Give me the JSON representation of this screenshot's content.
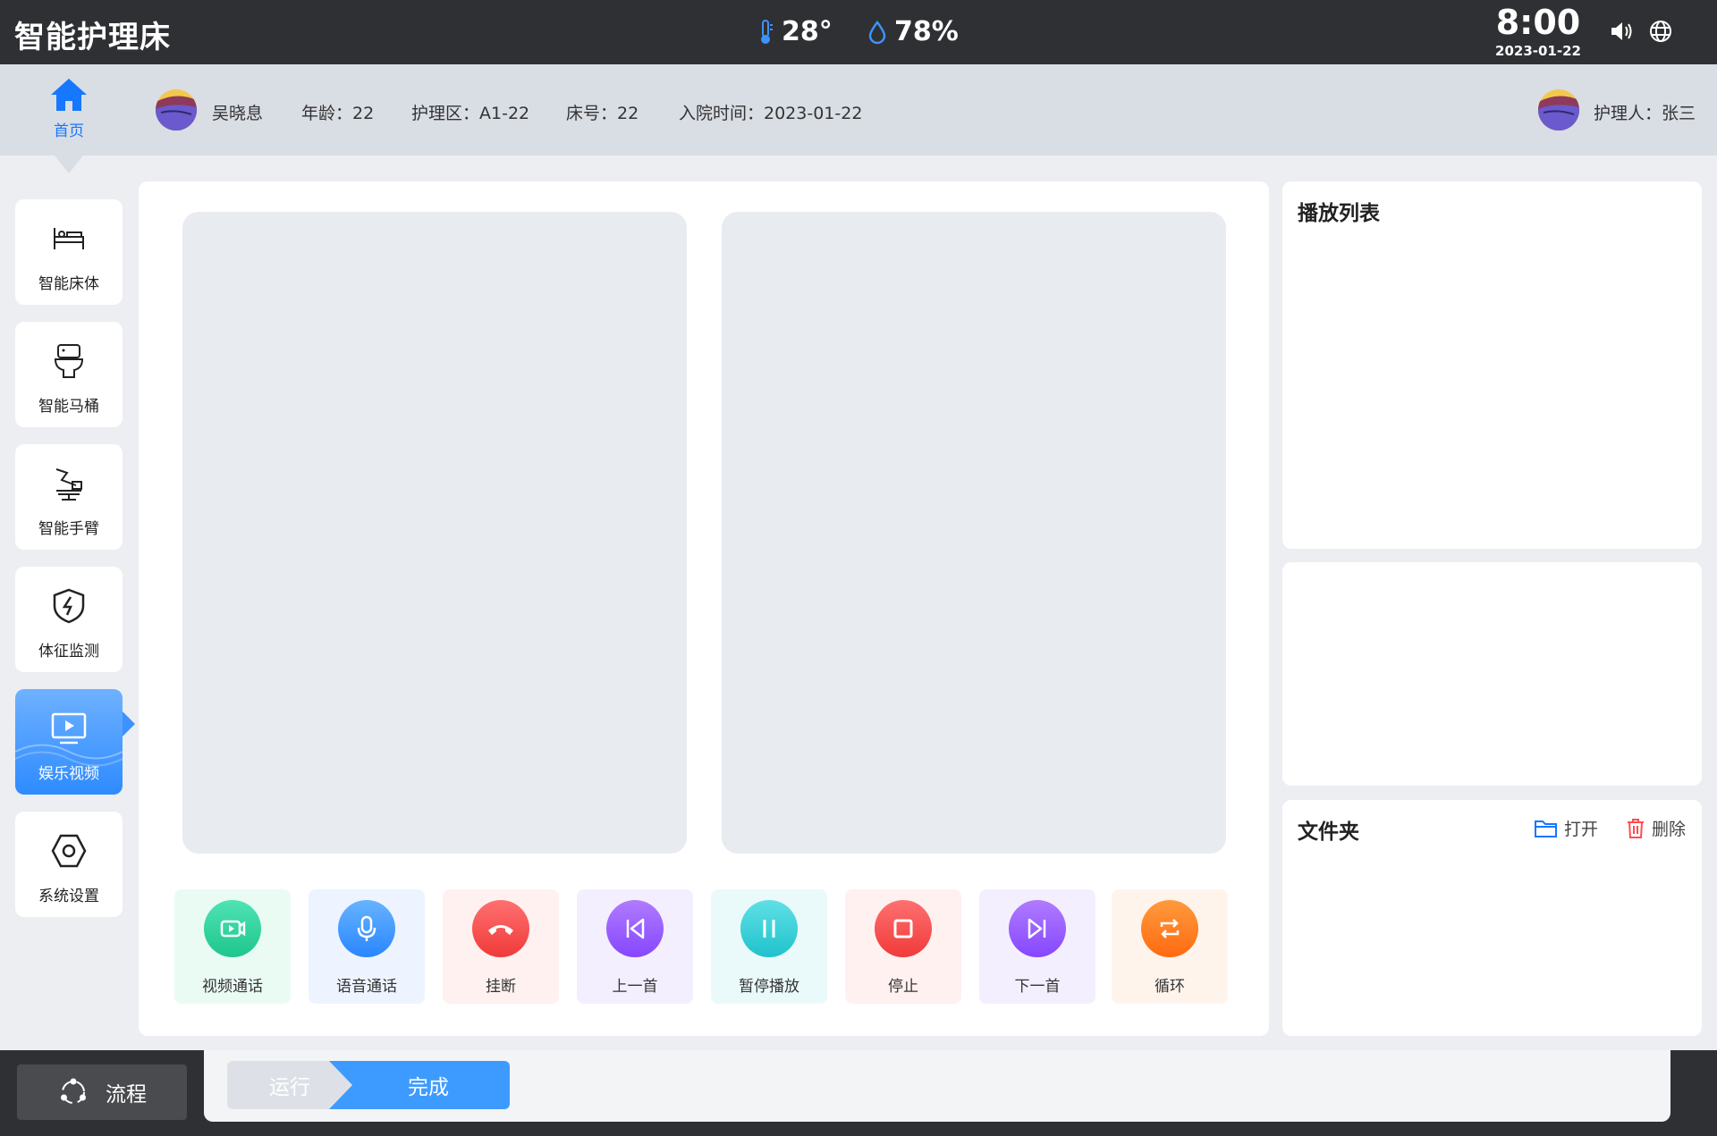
{
  "app": {
    "title": "智能护理床"
  },
  "environment": {
    "temperature": "28°",
    "humidity": "78%"
  },
  "clock": {
    "time": "8:00",
    "date": "2023-01-22"
  },
  "header": {
    "home_label": "首页",
    "patient_name": "吴晓息",
    "age": "年龄：22",
    "ward": "护理区：A1-22",
    "bed": "床号：22",
    "admission": "入院时间：2023-01-22",
    "nurse": "护理人：张三"
  },
  "sidebar": {
    "items": [
      {
        "label": "智能床体",
        "icon": "bed-icon"
      },
      {
        "label": "智能马桶",
        "icon": "toilet-icon"
      },
      {
        "label": "智能手臂",
        "icon": "robot-arm-icon"
      },
      {
        "label": "体征监测",
        "icon": "shield-icon"
      },
      {
        "label": "娱乐视频",
        "icon": "video-icon",
        "active": true
      },
      {
        "label": "系统设置",
        "icon": "hexagon-settings-icon"
      }
    ]
  },
  "controls": [
    {
      "label": "视频通话",
      "icon": "video-call-icon",
      "color": "#2fd6a0",
      "bg": "#eafbf4"
    },
    {
      "label": "语音通话",
      "icon": "microphone-icon",
      "color": "#3a94ff",
      "bg": "#edf4ff"
    },
    {
      "label": "挂断",
      "icon": "hang-up-icon",
      "color": "#ff4d4f",
      "bg": "#fff1f0"
    },
    {
      "label": "上一首",
      "icon": "previous-track-icon",
      "color": "#9b5cff",
      "bg": "#f4efff"
    },
    {
      "label": "暂停播放",
      "icon": "pause-icon",
      "color": "#2fd0d8",
      "bg": "#eafafb"
    },
    {
      "label": "停止",
      "icon": "stop-icon",
      "color": "#ff4d4f",
      "bg": "#fff1f0"
    },
    {
      "label": "下一首",
      "icon": "next-track-icon",
      "color": "#9b5cff",
      "bg": "#f4efff"
    },
    {
      "label": "循环",
      "icon": "loop-icon",
      "color": "#ff7a1a",
      "bg": "#fff4ec"
    }
  ],
  "playlist": {
    "title": "播放列表"
  },
  "folder": {
    "title": "文件夹",
    "open_label": "打开",
    "delete_label": "删除"
  },
  "workflow": {
    "button_label": "流程",
    "steps": [
      "运行",
      "完成"
    ]
  },
  "colors": {
    "accent": "#1677ff",
    "topbar": "#2f3033",
    "infobar": "#d9dde4"
  }
}
